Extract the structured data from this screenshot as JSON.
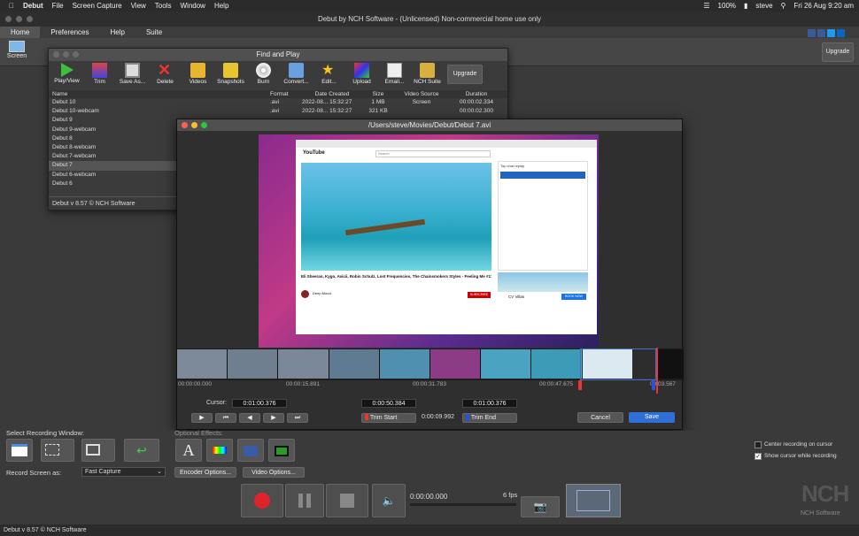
{
  "menubar": {
    "app": "Debut",
    "items": [
      "File",
      "Screen Capture",
      "View",
      "Tools",
      "Window",
      "Help"
    ],
    "title": "Debut by NCH Software - (Unlicensed) Non-commercial home use only",
    "battery": "100%",
    "user": "steve",
    "datetime": "Fri 26 Aug  9:20 am"
  },
  "tabs": [
    "Home",
    "Preferences",
    "Help",
    "Suite"
  ],
  "toolbar": {
    "screen_label": "Screen",
    "upgrade_label": "Upgrade"
  },
  "find": {
    "title": "Find and Play",
    "tools": [
      "Play/View",
      "Trim",
      "Save As...",
      "Delete",
      "Videos",
      "Snapshots",
      "Burn",
      "Convert...",
      "Edit...",
      "Upload",
      "Email...",
      "NCH Suite"
    ],
    "upgrade": "Upgrade",
    "columns": [
      "Name",
      "Format",
      "Date Created",
      "Size",
      "Video Source",
      "Duration"
    ],
    "rows": [
      {
        "name": "Debut 10",
        "format": ".avi",
        "date": "2022-08... 15:32:27",
        "size": "1 MB",
        "source": "Screen",
        "duration": "00:00:02.334"
      },
      {
        "name": "Debut 10-webcam",
        "format": ".avi",
        "date": "2022-08... 15:32:27",
        "size": "321 KB",
        "source": "",
        "duration": "00:00:02.300"
      },
      {
        "name": "Debut 9",
        "format": "",
        "date": "",
        "size": "",
        "source": "",
        "duration": ""
      },
      {
        "name": "Debut 9-webcam",
        "format": "",
        "date": "",
        "size": "",
        "source": "",
        "duration": ""
      },
      {
        "name": "Debut 8",
        "format": "",
        "date": "",
        "size": "",
        "source": "",
        "duration": ""
      },
      {
        "name": "Debut 8-webcam",
        "format": "",
        "date": "",
        "size": "",
        "source": "",
        "duration": ""
      },
      {
        "name": "Debut 7-webcam",
        "format": "",
        "date": "",
        "size": "",
        "source": "",
        "duration": ""
      },
      {
        "name": "Debut 7",
        "format": "",
        "date": "",
        "size": "",
        "source": "",
        "duration": ""
      },
      {
        "name": "Debut 6-webcam",
        "format": "",
        "date": "",
        "size": "",
        "source": "",
        "duration": ""
      },
      {
        "name": "Debut 6",
        "format": "",
        "date": "",
        "size": "",
        "source": "",
        "duration": ""
      }
    ],
    "footer": "Debut v 8.57 © NCH Software"
  },
  "player": {
    "title": "/Users/steve/Movies/Debut/Debut 7.avi",
    "video": {
      "yt_logo": "YouTube",
      "search": "Search",
      "video_title": "Eli Sheeran, Kygo, Avicii, Robin Schulz, Lost Frequencies, The Chainsmokers Styles - Feeling Me #175",
      "channel": "Deep Mood.",
      "subscribe": "SUBSCRIBE",
      "ad_title": "CV Villas",
      "ad_cta": "BOOK NOW",
      "top_chat": "Top chat replay"
    },
    "timeline_times": [
      "00:00:00.000",
      "00:00:15.891",
      "00:00:31.783",
      "00:00:47.675",
      "00:03.567"
    ],
    "cursor_label": "Cursor:",
    "cursor_value": "0:01:00.376",
    "trim_start_value": "0:00:50.384",
    "trim_end_value": "0:01:00.376",
    "trim_start_label": "Trim Start",
    "trim_end_label": "Trim End",
    "duration": "0:00:09.992",
    "cancel": "Cancel",
    "save": "Save"
  },
  "bottom": {
    "select_window": "Select Recording Window:",
    "optional_effects": "Optional Effects:",
    "record_as_label": "Record Screen as:",
    "record_as_value": "Fast Capture",
    "encoder": "Encoder Options...",
    "video_opts": "Video Options...",
    "center_record": "Center recording on cursor",
    "show_cursor": "Show cursor while recording",
    "time": "0:00:00.000",
    "fps": "6 fps",
    "nch": "NCH Software"
  },
  "status": "Debut v 8.57 © NCH Software",
  "colors": {
    "save": "#2f6fd6",
    "record": "#e0232a"
  }
}
